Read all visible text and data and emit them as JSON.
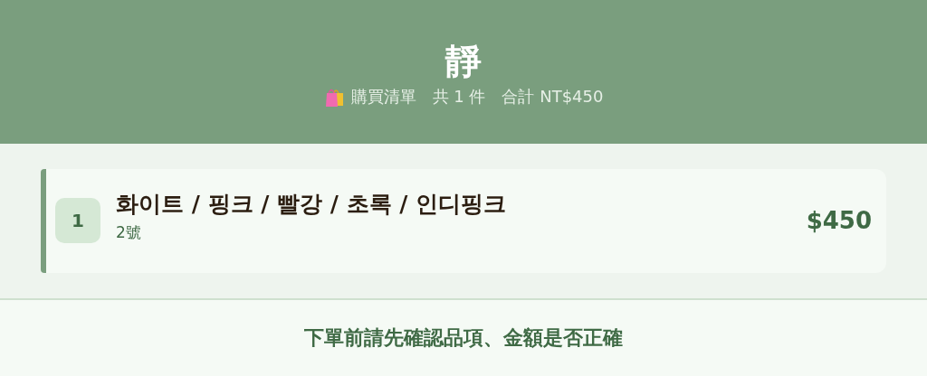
{
  "header": {
    "title": "靜",
    "subtitle": {
      "list_label": "購買清單",
      "count": "共 1 件",
      "total": "合計 NT$450"
    }
  },
  "items": [
    {
      "index": "1",
      "name": "화이트 / 핑크 / 빨강 / 초록 / 인디핑크",
      "size": "2號",
      "price": "$450"
    }
  ],
  "footer": {
    "notice": "下單前請先確認品項、金額是否正確"
  }
}
